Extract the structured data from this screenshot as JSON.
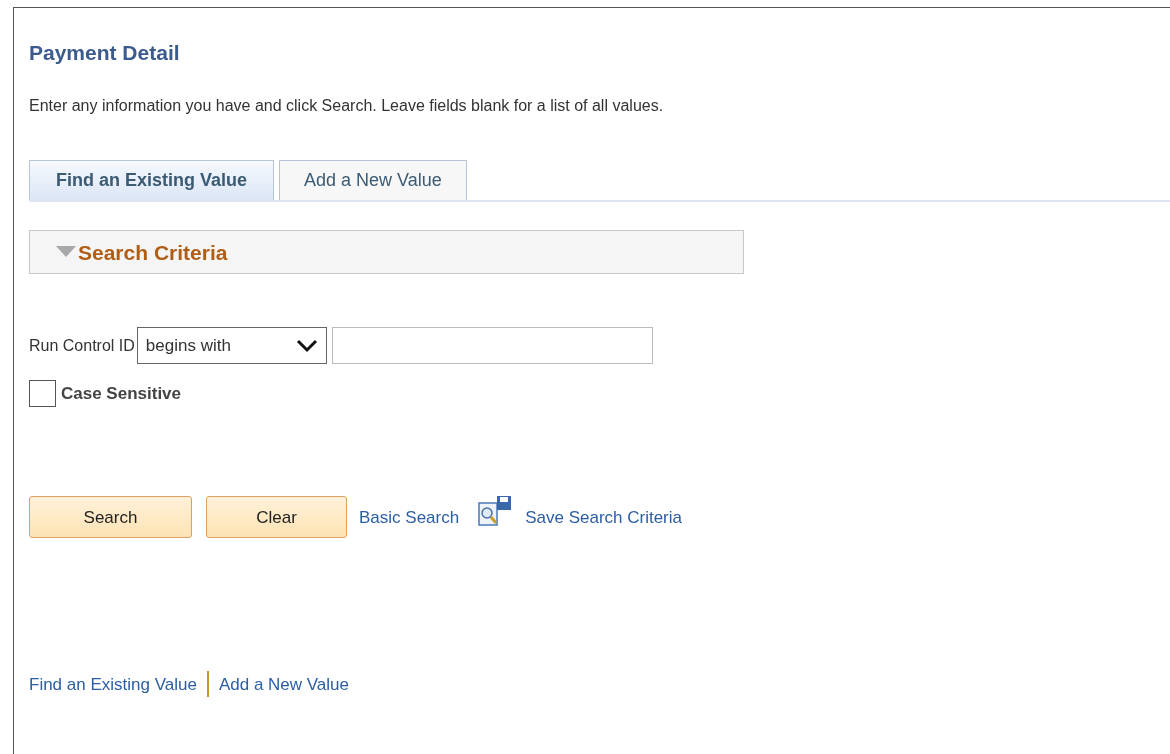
{
  "page": {
    "title": "Payment Detail",
    "instructions": "Enter any information you have and click Search. Leave fields blank for a list of all values."
  },
  "tabs": [
    {
      "label": "Find an Existing Value",
      "selected": true
    },
    {
      "label": "Add a New Value",
      "selected": false
    }
  ],
  "search_criteria": {
    "title": "Search Criteria",
    "expanded": true,
    "field": {
      "label": "Run Control ID",
      "operator": "begins with"
    },
    "case_sensitive": {
      "label": "Case Sensitive",
      "checked": false
    }
  },
  "buttons": [
    "Search",
    "Clear"
  ],
  "links": [
    "Basic Search",
    "Save Search Criteria"
  ],
  "footer_links": [
    "Find an Existing Value",
    "Add a New Value"
  ]
}
